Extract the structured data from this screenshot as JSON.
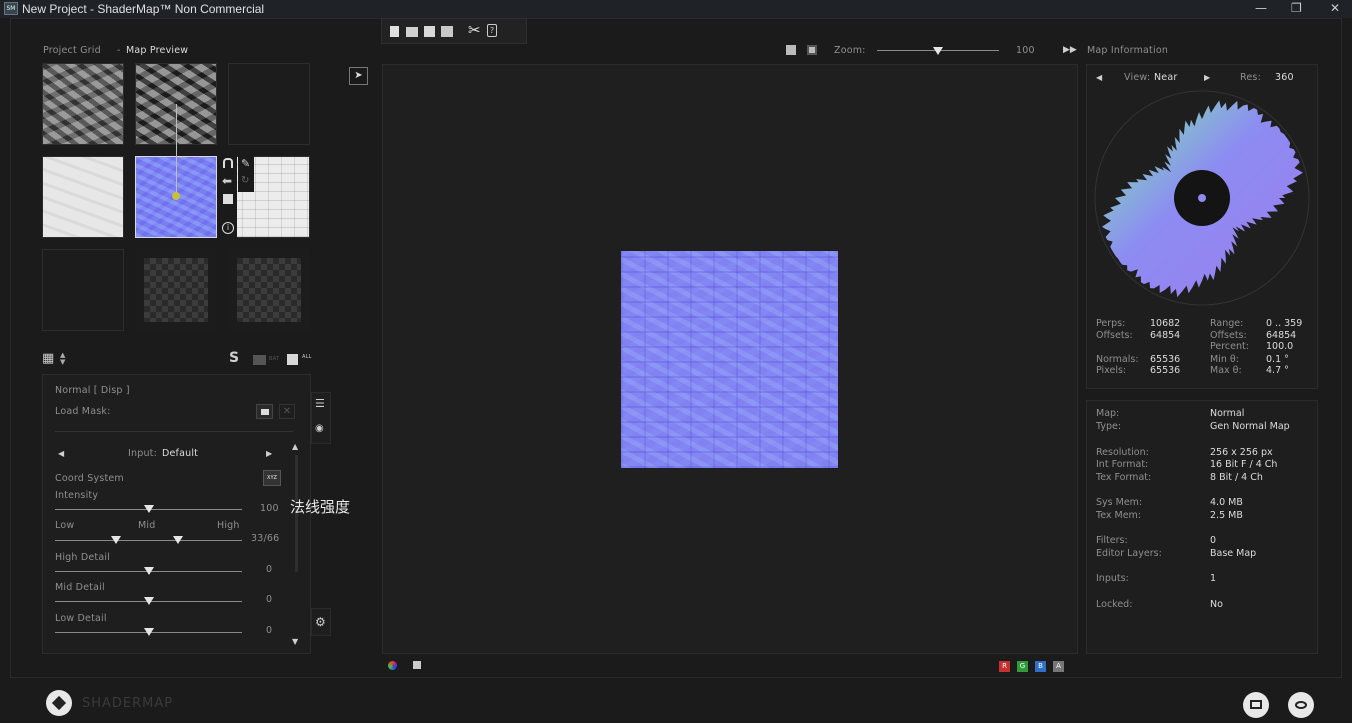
{
  "window": {
    "title": "New Project - ShaderMap™ Non Commercial",
    "app_icon": "SM",
    "min": "—",
    "max": "❐",
    "close": "✕"
  },
  "toolbar": {
    "icons": [
      "new-file-icon",
      "open-folder-icon",
      "save-icon",
      "save-as-icon",
      "tools-icon",
      "help-icon"
    ]
  },
  "left": {
    "breadcrumb_a": "Project Grid",
    "breadcrumb_sep": "-",
    "breadcrumb_b": "Map Preview",
    "controls_icons": [
      "grid-icon",
      "sort-arrows-icon",
      "shader-icon",
      "folder-icon",
      "save-all-icon"
    ],
    "save_all_label": "ALL",
    "bat_label": "BAT"
  },
  "props": {
    "title": "Normal [ Disp ]",
    "load_mask": "Load Mask:",
    "input_label": "Input:",
    "input_value": "Default",
    "coord_system": "Coord System",
    "xyz": "XYZ",
    "intensity": "Intensity",
    "intensity_value": "100",
    "intensity_level": 0.5,
    "annotation": "法线强度",
    "low": "Low",
    "mid": "Mid",
    "high": "High",
    "range_value": "33/66",
    "high_detail": "High Detail",
    "high_detail_value": "0",
    "mid_detail": "Mid Detail",
    "mid_detail_value": "0",
    "low_detail": "Low Detail",
    "low_detail_value": "0"
  },
  "view": {
    "zoom_label": "Zoom:",
    "zoom_value": "100",
    "zoom_level": 0.5
  },
  "map_info": {
    "header": "Map Information",
    "view_label": "View:",
    "view_value": "Near",
    "res_label": "Res:",
    "res_value": "360",
    "stats": [
      {
        "k": "Perps:",
        "v": "10682",
        "k2": "Range:",
        "v2": "0 .. 359"
      },
      {
        "k": "Offsets:",
        "v": "64854",
        "k2": "Offsets:",
        "v2": "64854"
      },
      {
        "k": "",
        "v": "",
        "k2": "Percent:",
        "v2": "100.0"
      },
      {
        "k": "Normals:",
        "v": "65536",
        "k2": "Min θ:",
        "v2": "0.1 °"
      },
      {
        "k": "Pixels:",
        "v": "65536",
        "k2": "Max θ:",
        "v2": "4.7 °"
      }
    ],
    "details": [
      {
        "k": "Map:",
        "v": "Normal"
      },
      {
        "k": "Type:",
        "v": "Gen Normal Map"
      },
      {
        "k": "Resolution:",
        "v": "256 x 256 px"
      },
      {
        "k": "Int Format:",
        "v": "16 Bit F / 4 Ch"
      },
      {
        "k": "Tex Format:",
        "v": "8 Bit / 4 Ch"
      },
      {
        "k": "Sys Mem:",
        "v": "4.0 MB"
      },
      {
        "k": "Tex Mem:",
        "v": "2.5 MB"
      },
      {
        "k": "Filters:",
        "v": "0"
      },
      {
        "k": "Editor Layers:",
        "v": "Base Map"
      },
      {
        "k": "Inputs:",
        "v": "1"
      },
      {
        "k": "Locked:",
        "v": "No"
      }
    ]
  },
  "channels": [
    "R",
    "G",
    "B",
    "A"
  ],
  "footer": {
    "brand": "SHADERMAP"
  }
}
